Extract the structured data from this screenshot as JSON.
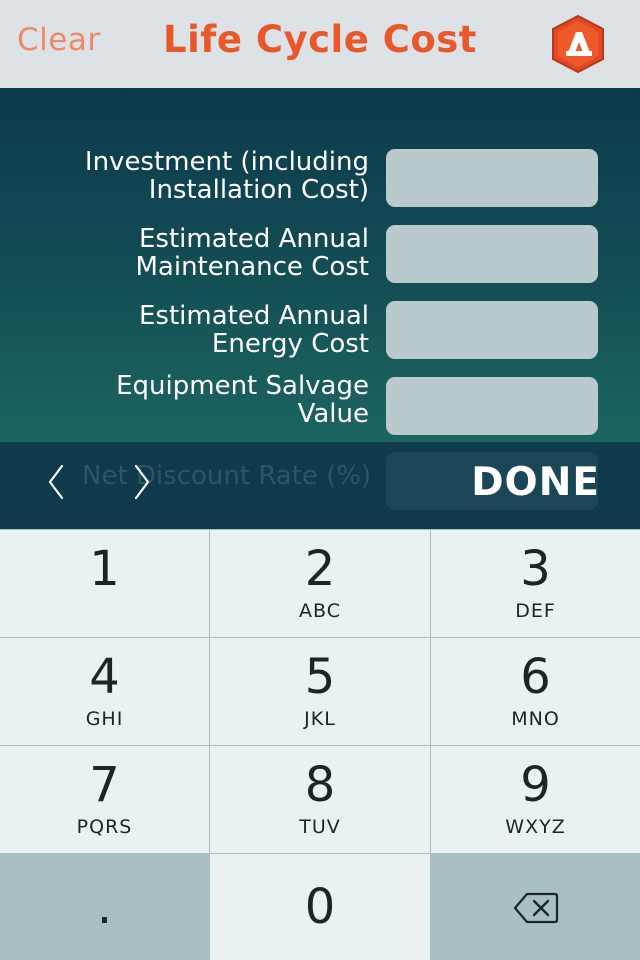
{
  "header": {
    "clear_label": "Clear",
    "title": "Life Cycle Cost",
    "logo_icon": "app-logo-icon"
  },
  "form": {
    "fields": [
      {
        "label_line1": "Investment (including",
        "label_line2": "Installation Cost)",
        "value": ""
      },
      {
        "label_line1": "Estimated Annual",
        "label_line2": "Maintenance Cost",
        "value": ""
      },
      {
        "label_line1": "Estimated Annual",
        "label_line2": "Energy Cost",
        "value": ""
      },
      {
        "label_line1": "Equipment Salvage",
        "label_line2": "Value",
        "value": ""
      }
    ],
    "hidden_field_label": "Net Discount Rate (%)"
  },
  "toolbar": {
    "prev_icon": "chevron-left-icon",
    "next_icon": "chevron-right-icon",
    "done_label": "DONE"
  },
  "keypad": {
    "keys": [
      {
        "digit": "1",
        "letters": ""
      },
      {
        "digit": "2",
        "letters": "ABC"
      },
      {
        "digit": "3",
        "letters": "DEF"
      },
      {
        "digit": "4",
        "letters": "GHI"
      },
      {
        "digit": "5",
        "letters": "JKL"
      },
      {
        "digit": "6",
        "letters": "MNO"
      },
      {
        "digit": "7",
        "letters": "PQRS"
      },
      {
        "digit": "8",
        "letters": "TUV"
      },
      {
        "digit": "9",
        "letters": "WXYZ"
      }
    ],
    "dot_label": ".",
    "zero_label": "0",
    "backspace_icon": "backspace-icon"
  },
  "colors": {
    "accent": "#e9582a",
    "form_bg_top": "#0c3a4c",
    "form_bg_bottom": "#1c6560",
    "input_bg": "#b9c9cc",
    "key_bg": "#e9f1f2",
    "key_dark_bg": "#a9c0c1"
  }
}
